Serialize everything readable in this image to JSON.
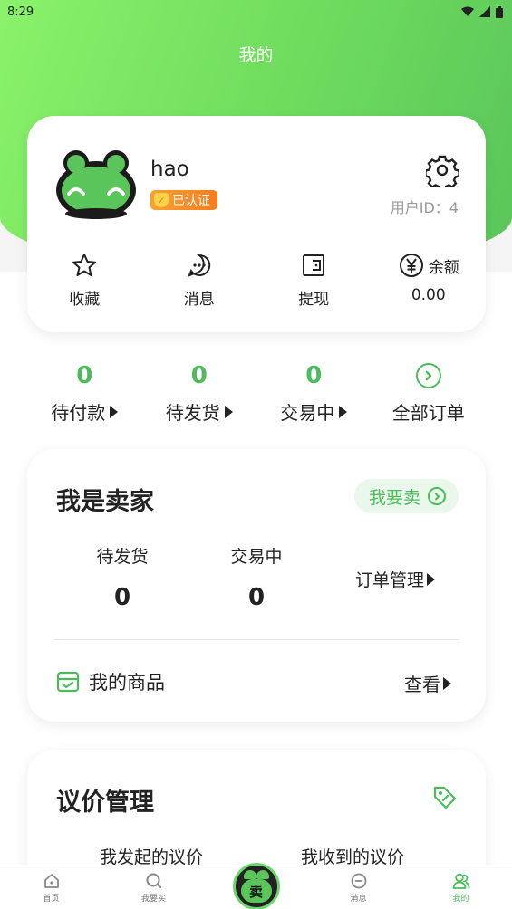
{
  "status": {
    "time": "8:29"
  },
  "header": {
    "title": "我的"
  },
  "profile": {
    "username": "hao",
    "badge": "已认证",
    "user_id": "用户ID：4"
  },
  "quick_actions": [
    {
      "label": "收藏",
      "icon": "star-icon"
    },
    {
      "label": "消息",
      "icon": "chat-icon"
    },
    {
      "label": "提现",
      "icon": "wallet-icon"
    }
  ],
  "balance": {
    "label": "余额",
    "value": "0.00",
    "icon": "yen-icon"
  },
  "orders": [
    {
      "count": "0",
      "label": "待付款"
    },
    {
      "count": "0",
      "label": "待发货"
    },
    {
      "count": "0",
      "label": "交易中"
    },
    {
      "label": "全部订单"
    }
  ],
  "seller": {
    "title": "我是卖家",
    "sell_button": "我要卖",
    "stats": [
      {
        "label": "待发货",
        "value": "0"
      },
      {
        "label": "交易中",
        "value": "0"
      }
    ],
    "order_manage": "订单管理",
    "my_goods": "我的商品",
    "view": "查看"
  },
  "negotiation": {
    "title": "议价管理",
    "tabs": [
      "我发起的议价",
      "我收到的议价"
    ]
  },
  "tabbar": {
    "items": [
      {
        "label": "首页",
        "icon": "home-icon"
      },
      {
        "label": "我要买",
        "icon": "search-icon"
      },
      {
        "label": "卖",
        "icon": "sell-icon"
      },
      {
        "label": "消息",
        "icon": "message-icon"
      },
      {
        "label": "我的",
        "icon": "user-icon"
      }
    ],
    "active": "我的"
  },
  "colors": {
    "accent": "#4cbb5c",
    "header_green": "#7ee266",
    "badge_orange": "#f57c1f"
  }
}
